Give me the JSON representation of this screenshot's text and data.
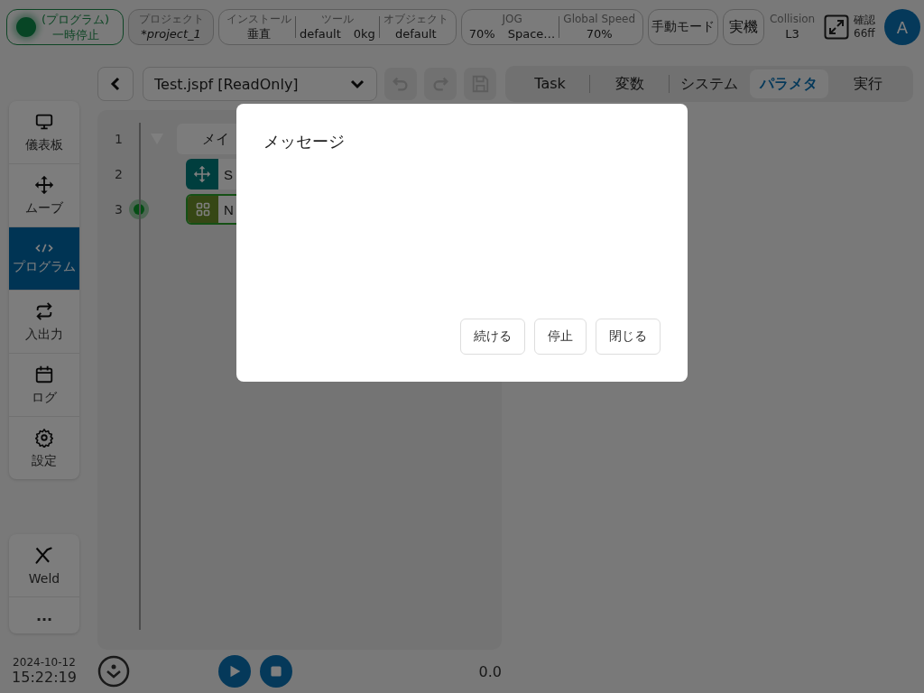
{
  "status": {
    "line1": "(プログラム)",
    "line2": "一時停止"
  },
  "project": {
    "label": "プロジェクト",
    "value": "*project_1"
  },
  "robot_info": [
    {
      "label": "インストール",
      "values": [
        "垂直"
      ]
    },
    {
      "label": "ツール",
      "values": [
        "default",
        "0kg"
      ]
    },
    {
      "label": "オブジェクト",
      "values": [
        "default"
      ]
    }
  ],
  "speed_info": [
    {
      "label": "JOG",
      "values": [
        "70%",
        "Space…"
      ]
    },
    {
      "label": "Global Speed",
      "values": [
        "70%"
      ]
    }
  ],
  "mode_buttons": [
    "手動モード",
    "実機"
  ],
  "collision": {
    "label": "Collision",
    "value": "L3"
  },
  "confirm": {
    "label": "確認",
    "value": "66ff"
  },
  "avatar": "A",
  "file": "Test.jspf [ReadOnly]",
  "edit_buttons": [
    {
      "kind": "undo",
      "disabled": true
    },
    {
      "kind": "redo",
      "disabled": true
    },
    {
      "kind": "save",
      "disabled": true
    }
  ],
  "tabs": [
    {
      "label": "Task",
      "selected": false
    },
    {
      "label": "変数",
      "selected": false
    },
    {
      "label": "システム",
      "selected": false
    },
    {
      "label": "パラメタ",
      "selected": true
    },
    {
      "label": "実行",
      "selected": false
    }
  ],
  "sidebar": [
    {
      "label": "儀表板",
      "kind": "monitor",
      "selected": false
    },
    {
      "label": "ムーブ",
      "kind": "move",
      "selected": false
    },
    {
      "label": "プログラム",
      "kind": "code",
      "selected": true
    },
    {
      "label": "入出力",
      "kind": "io",
      "selected": false
    },
    {
      "label": "ログ",
      "kind": "calendar",
      "selected": false
    },
    {
      "label": "設定",
      "kind": "gear",
      "selected": false
    }
  ],
  "extra_tools": [
    {
      "label": "Weld",
      "kind": "weld"
    },
    {
      "label": "...",
      "kind": "more"
    }
  ],
  "datetime": {
    "date": "2024-10-12",
    "time": "15:22:19"
  },
  "program": [
    {
      "line": "1",
      "kind": "main",
      "text": "メイ",
      "current": false
    },
    {
      "line": "2",
      "kind": "move",
      "text": "S",
      "current": false
    },
    {
      "line": "3",
      "kind": "node",
      "text": "N",
      "current": true
    }
  ],
  "footer": {
    "value": "0.0"
  },
  "dialog": {
    "title": "メッセージ",
    "buttons": [
      "続ける",
      "停止",
      "閉じる"
    ]
  }
}
